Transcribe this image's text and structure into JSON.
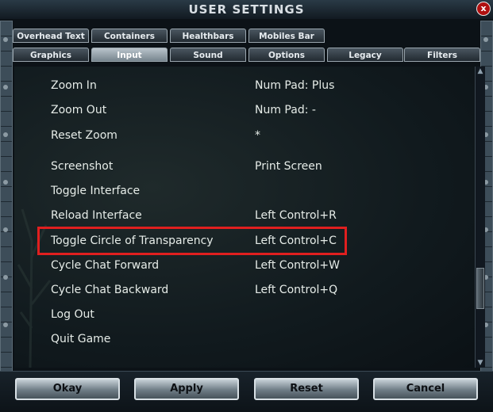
{
  "window": {
    "title": "USER SETTINGS",
    "close_symbol": "x"
  },
  "tabs_row1": [
    {
      "label": "Overhead Text",
      "active": false
    },
    {
      "label": "Containers",
      "active": false
    },
    {
      "label": "Healthbars",
      "active": false
    },
    {
      "label": "Mobiles Bar",
      "active": false
    }
  ],
  "tabs_row2": [
    {
      "label": "Graphics",
      "active": false
    },
    {
      "label": "Input",
      "active": true
    },
    {
      "label": "Sound",
      "active": false
    },
    {
      "label": "Options",
      "active": false
    },
    {
      "label": "Legacy",
      "active": false
    },
    {
      "label": "Filters",
      "active": false
    }
  ],
  "bindings": [
    {
      "action": "Zoom In",
      "key": "Num Pad: Plus"
    },
    {
      "action": "Zoom Out",
      "key": "Num Pad: -"
    },
    {
      "action": "Reset Zoom",
      "key": "*"
    },
    {
      "action": "Screenshot",
      "key": "Print Screen"
    },
    {
      "action": "Toggle Interface",
      "key": ""
    },
    {
      "action": "Reload Interface",
      "key": "Left Control+R"
    },
    {
      "action": "Toggle Circle of Transparency",
      "key": "Left Control+C"
    },
    {
      "action": "Cycle Chat Forward",
      "key": "Left Control+W"
    },
    {
      "action": "Cycle Chat Backward",
      "key": "Left Control+Q"
    },
    {
      "action": "Log Out",
      "key": ""
    },
    {
      "action": "Quit Game",
      "key": ""
    }
  ],
  "highlighted_binding": "Toggle Circle of Transparency",
  "buttons": {
    "okay": "Okay",
    "apply": "Apply",
    "reset": "Reset",
    "cancel": "Cancel"
  },
  "scrollbar": {
    "up_arrow": "▲",
    "down_arrow": "▼"
  },
  "colors": {
    "highlight_border": "#e01f1f",
    "tab_active": "#9aa6ae",
    "text": "#e6ece8"
  }
}
